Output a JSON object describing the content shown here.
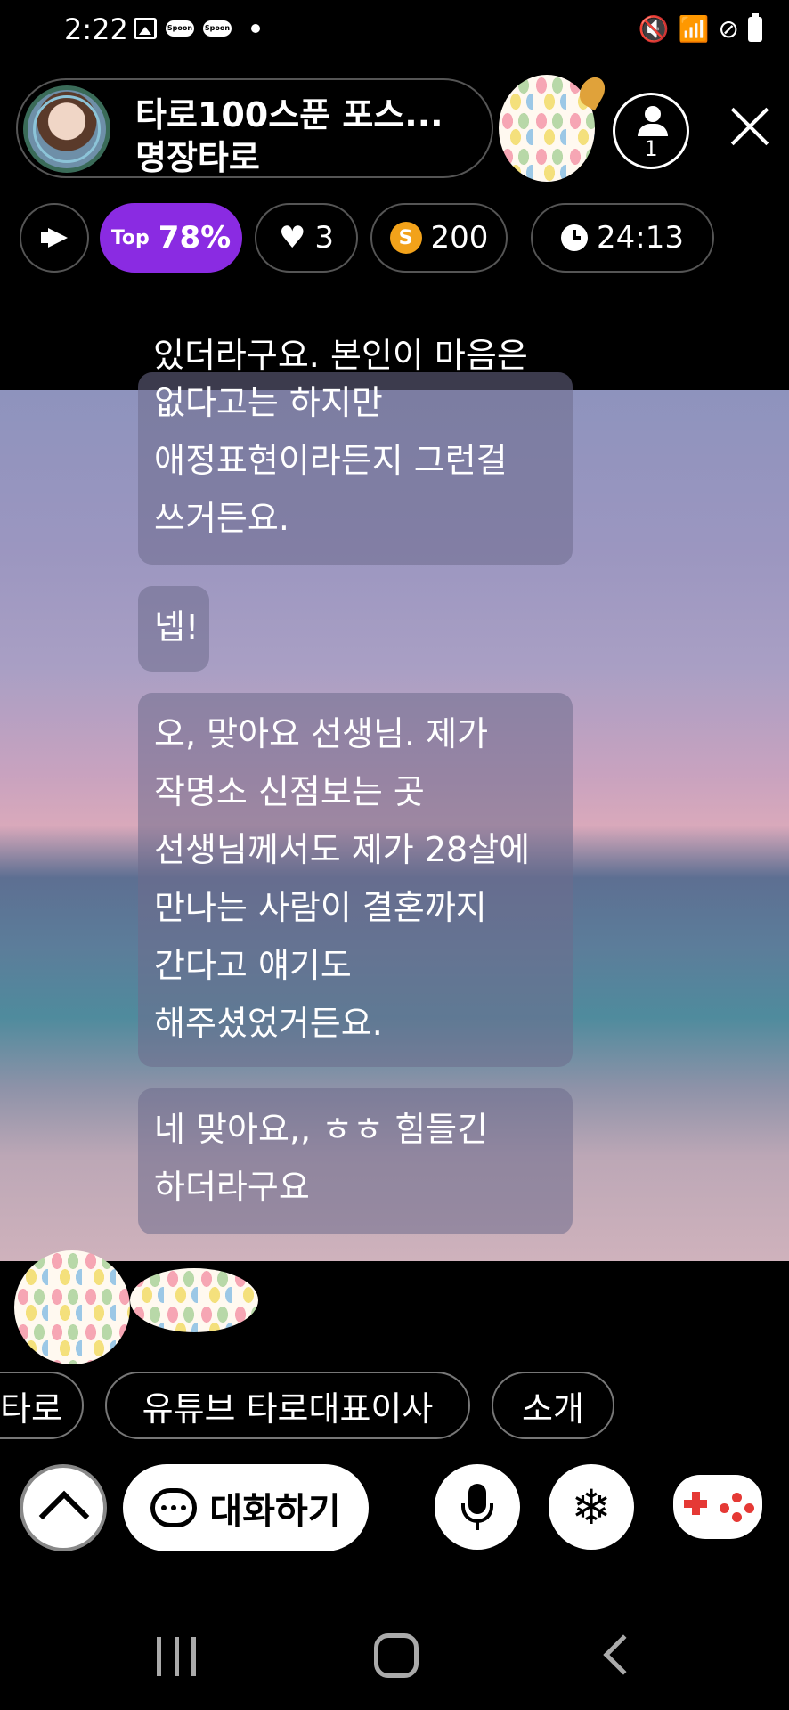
{
  "status_bar": {
    "time": "2:22",
    "left_icons": [
      "image-icon",
      "spoon-icon",
      "spoon-icon",
      "dot-icon"
    ],
    "right_icons": [
      "mute-icon",
      "wifi-icon",
      "blocked-icon",
      "battery-icon"
    ],
    "spoon_badge": "Spoon"
  },
  "header": {
    "host_title": "타로100스푼 포스...",
    "host_subtitle": "명장타로",
    "listener_count": "1"
  },
  "stats": {
    "top_prefix": "Top",
    "top_value": "78%",
    "likes": "3",
    "spoons": "200",
    "coin_letter": "S",
    "timer": "24:13",
    "top_color": "#8a2be2"
  },
  "chat": {
    "top_line": "있더라구요. 본인이 마음은",
    "messages": [
      {
        "lines": [
          "없다고는 하지만",
          "애정표현이라든지 그런걸",
          "쓰거든요."
        ]
      },
      {
        "lines": [
          "넵!"
        ]
      },
      {
        "lines": [
          "오, 맞아요 선생님. 제가",
          "작명소 신점보는 곳",
          "선생님께서도 제가 28살에",
          "만나는 사람이 결혼까지",
          "간다고 얘기도",
          "해주셨었거든요."
        ]
      },
      {
        "lines": [
          "네 맞아요,, ㅎㅎ 힘들긴",
          "하더라구요"
        ]
      }
    ]
  },
  "tags": [
    "타로",
    "유튜브 타로대표이사",
    "소개"
  ],
  "controls": {
    "chat_button": "대화하기",
    "snow_glyph": "❄"
  }
}
